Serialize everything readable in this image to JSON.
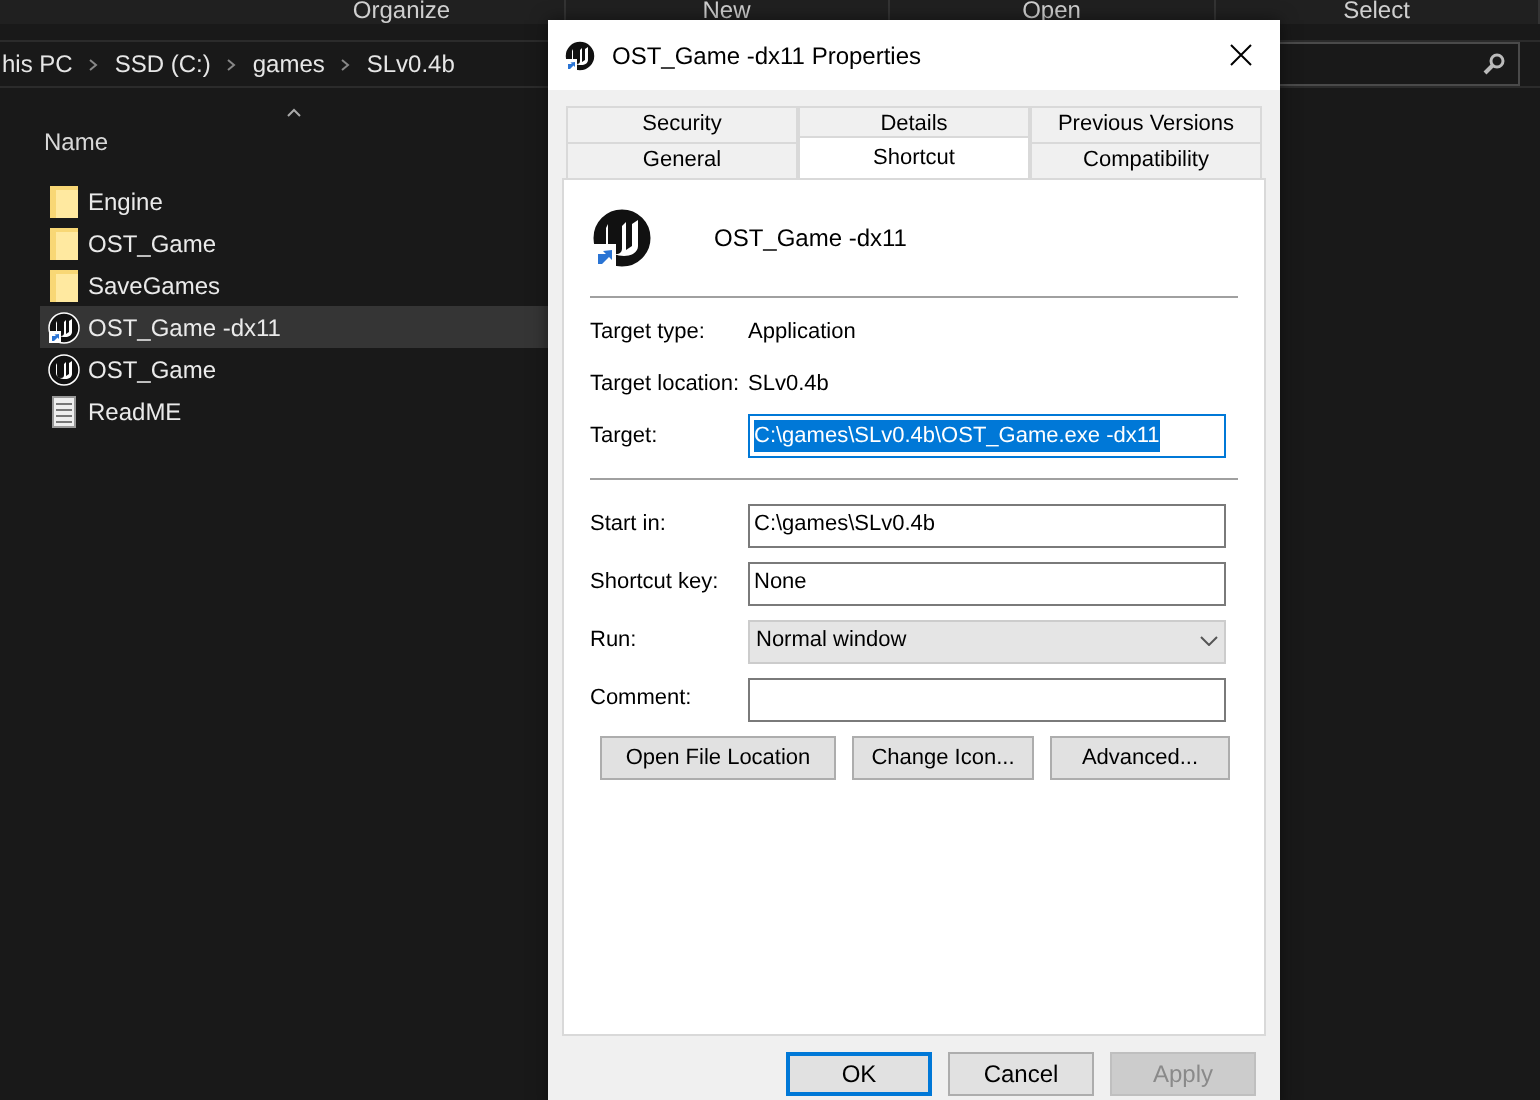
{
  "ribbon": [
    "Organize",
    "New",
    "Open",
    "Select"
  ],
  "breadcrumb": [
    "his PC",
    "SSD (C:)",
    "games",
    "SLv0.4b"
  ],
  "file_list": {
    "column": "Name",
    "items": [
      {
        "name": "Engine",
        "kind": "folder",
        "selected": false
      },
      {
        "name": "OST_Game",
        "kind": "folder",
        "selected": false
      },
      {
        "name": "SaveGames",
        "kind": "folder",
        "selected": false
      },
      {
        "name": "OST_Game -dx11",
        "kind": "shortcut",
        "selected": true
      },
      {
        "name": "OST_Game",
        "kind": "app",
        "selected": false
      },
      {
        "name": "ReadME",
        "kind": "text",
        "selected": false
      }
    ]
  },
  "dialog": {
    "title": "OST_Game -dx11 Properties",
    "tab_rows": [
      [
        {
          "label": "Security",
          "selected": false
        },
        {
          "label": "Details",
          "selected": false
        },
        {
          "label": "Previous Versions",
          "selected": false
        }
      ],
      [
        {
          "label": "General",
          "selected": false
        },
        {
          "label": "Shortcut",
          "selected": true
        },
        {
          "label": "Compatibility",
          "selected": false
        }
      ]
    ],
    "shortcut_name": "OST_Game -dx11",
    "info": [
      {
        "label": "Target type:",
        "value": "Application"
      },
      {
        "label": "Target location:",
        "value": "SLv0.4b"
      }
    ],
    "target": {
      "label": "Target:",
      "value": "C:\\games\\SLv0.4b\\OST_Game.exe -dx11"
    },
    "fields": [
      {
        "label": "Start in:",
        "value": "C:\\games\\SLv0.4b",
        "kind": "text"
      },
      {
        "label": "Shortcut key:",
        "value": "None",
        "kind": "text"
      },
      {
        "label": "Run:",
        "value": "Normal window",
        "kind": "select"
      },
      {
        "label": "Comment:",
        "kind": "text"
      }
    ],
    "actions": [
      "Open File Location",
      "Change Icon...",
      "Advanced..."
    ],
    "buttons": [
      {
        "label": "OK",
        "disabled": false,
        "default": true
      },
      {
        "label": "Cancel",
        "disabled": false,
        "default": false
      },
      {
        "label": "Apply",
        "disabled": true,
        "default": false
      }
    ]
  }
}
